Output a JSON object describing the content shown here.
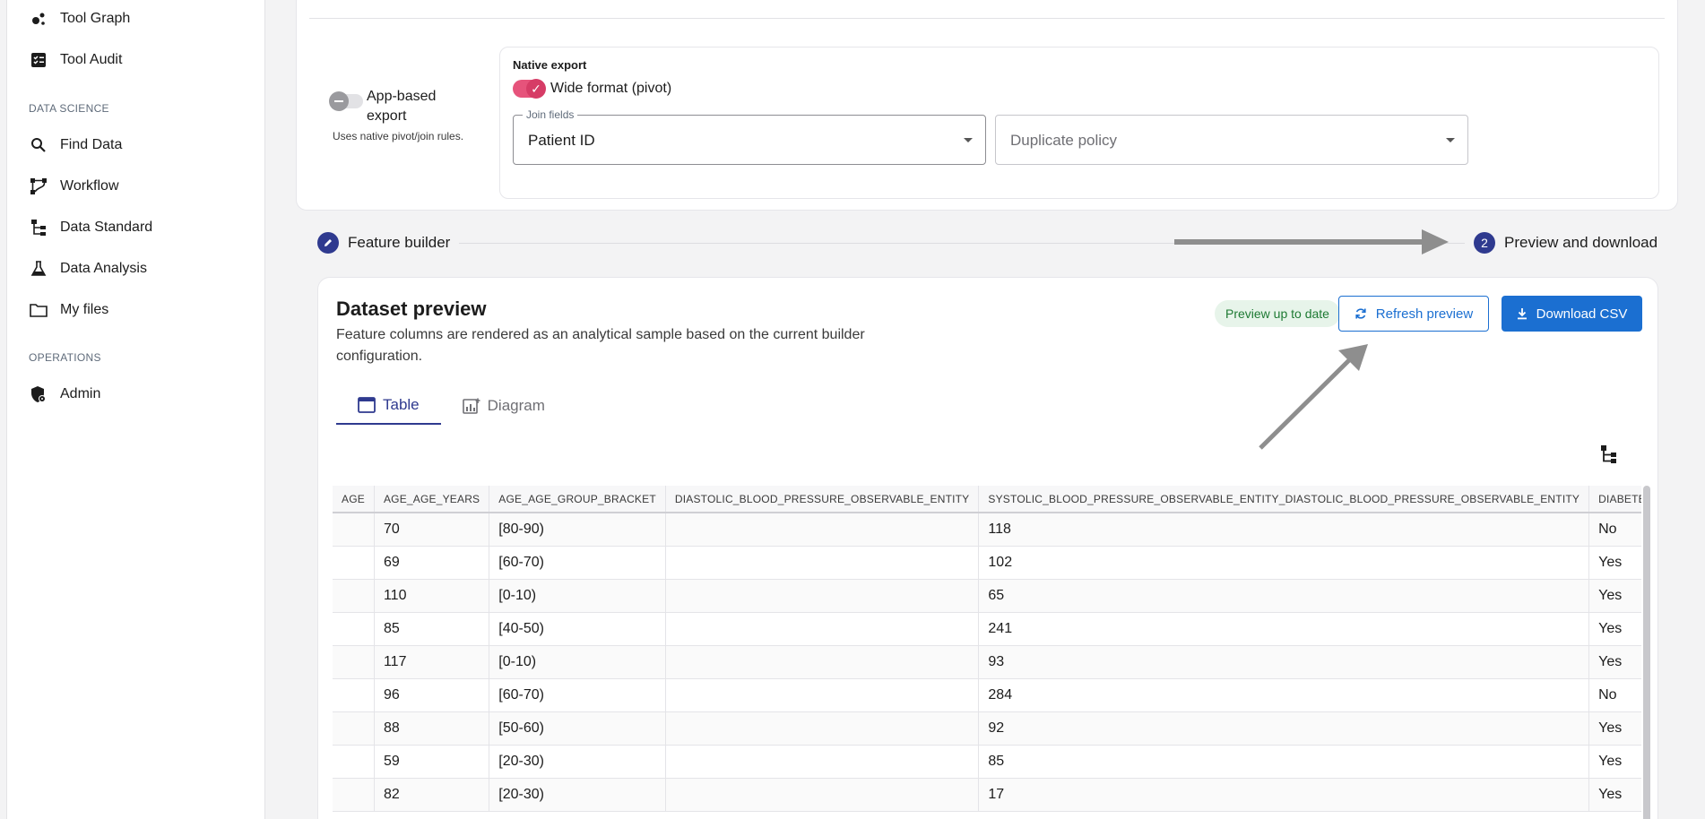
{
  "sidebar": {
    "items_top": [
      {
        "label": "Tool Graph",
        "icon": "graph-icon"
      },
      {
        "label": "Tool Audit",
        "icon": "audit-icon"
      }
    ],
    "section_data_science": "DATA SCIENCE",
    "items_ds": [
      {
        "label": "Find Data",
        "icon": "search-icon"
      },
      {
        "label": "Workflow",
        "icon": "workflow-icon"
      },
      {
        "label": "Data Standard",
        "icon": "hierarchy-icon"
      },
      {
        "label": "Data Analysis",
        "icon": "flask-icon"
      },
      {
        "label": "My files",
        "icon": "folder-icon"
      }
    ],
    "section_operations": "OPERATIONS",
    "items_ops": [
      {
        "label": "Admin",
        "icon": "shield-gear-icon"
      }
    ]
  },
  "export": {
    "toggle_label": "App-based export",
    "toggle_help": "Uses native pivot/join rules.",
    "native_title": "Native export",
    "wide_format_label": "Wide format (pivot)",
    "join_fields_legend": "Join fields",
    "join_fields_value": "Patient ID",
    "duplicate_policy_placeholder": "Duplicate policy"
  },
  "stepper": {
    "step1_label": "Feature builder",
    "step2_number": "2",
    "step2_label": "Preview and download"
  },
  "preview": {
    "title": "Dataset preview",
    "description": "Feature columns are rendered as an analytical sample based on the current builder configuration.",
    "badge": "Preview up to date",
    "refresh_label": "Refresh preview",
    "download_label": "Download CSV",
    "tabs": [
      {
        "label": "Table",
        "active": true
      },
      {
        "label": "Diagram",
        "active": false
      }
    ]
  },
  "table": {
    "columns": [
      "AGE",
      "AGE_AGE_YEARS",
      "AGE_AGE_GROUP_BRACKET",
      "DIASTOLIC_BLOOD_PRESSURE_OBSERVABLE_ENTITY",
      "SYSTOLIC_BLOOD_PRESSURE_OBSERVABLE_ENTITY_DIASTOLIC_BLOOD_PRESSURE_OBSERVABLE_ENTITY",
      "DIABETES"
    ],
    "rows": [
      [
        "",
        "70",
        "[80-90)",
        "",
        "118",
        "No"
      ],
      [
        "",
        "69",
        "[60-70)",
        "",
        "102",
        "Yes"
      ],
      [
        "",
        "110",
        "[0-10)",
        "",
        "65",
        "Yes"
      ],
      [
        "",
        "85",
        "[40-50)",
        "",
        "241",
        "Yes"
      ],
      [
        "",
        "117",
        "[0-10)",
        "",
        "93",
        "Yes"
      ],
      [
        "",
        "96",
        "[60-70)",
        "",
        "284",
        "No"
      ],
      [
        "",
        "88",
        "[50-60)",
        "",
        "92",
        "Yes"
      ],
      [
        "",
        "59",
        "[20-30)",
        "",
        "85",
        "Yes"
      ],
      [
        "",
        "82",
        "[20-30)",
        "",
        "17",
        "Yes"
      ]
    ]
  },
  "colors": {
    "accent": "#1b6fd1",
    "stepper": "#2f3a8f",
    "badge_bg": "#e7f4ea",
    "badge_text": "#1e7a33",
    "toggle_on": "#d63c66"
  }
}
